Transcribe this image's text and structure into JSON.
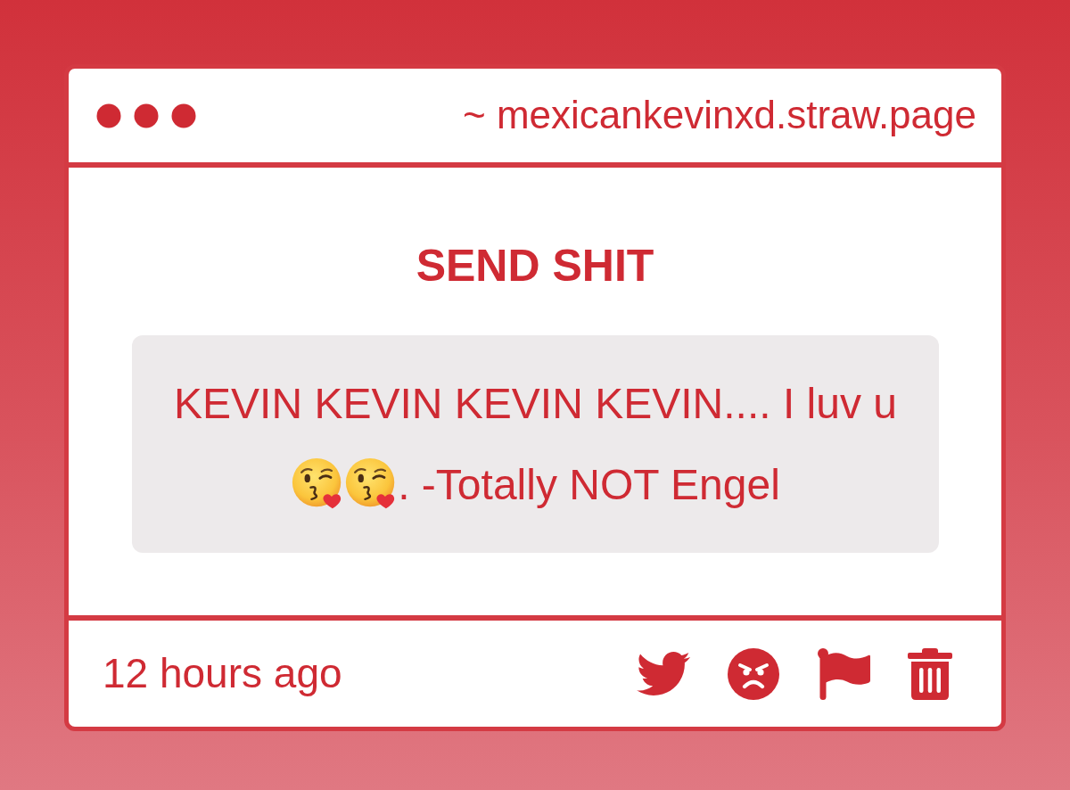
{
  "window": {
    "address": "~ mexicankevinxd.straw.page"
  },
  "title": "SEND SHIT",
  "message": {
    "parts": [
      {
        "kind": "text",
        "text": "KEVIN KEVIN KEVIN KEVIN.... I luv u"
      },
      {
        "kind": "emoji"
      },
      {
        "kind": "emoji"
      },
      {
        "kind": "text",
        "text": ". -Totally NOT Engel"
      }
    ]
  },
  "footer": {
    "time": "12 hours ago"
  }
}
